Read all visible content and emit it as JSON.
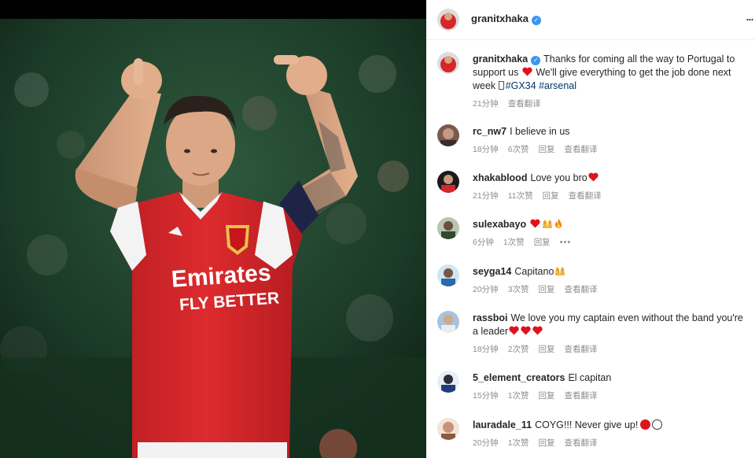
{
  "post": {
    "author": "granitxhaka",
    "verified": true,
    "more_label": "...",
    "photo_jersey_sponsor_line1": "Emirates",
    "photo_jersey_sponsor_line2": "FLY BETTER"
  },
  "caption": {
    "user": "granitxhaka",
    "text_a": "Thanks for coming all the way to Portugal to support us",
    "text_b": "We'll give everything to get the job done next week",
    "hashtag_1": "#GX34",
    "hashtag_2": "#arsenal",
    "time": "21分钟",
    "translate": "查看翻译"
  },
  "labels": {
    "reply": "回复",
    "translate": "查看翻译"
  },
  "comments": [
    {
      "user": "rc_nw7",
      "text": "I believe in us",
      "time": "18分钟",
      "likes": "6次赞"
    },
    {
      "user": "xhakablood",
      "text": "Love you bro",
      "time": "21分钟",
      "likes": "11次赞"
    },
    {
      "user": "sulexabayo",
      "text": "",
      "time": "6分钟",
      "likes": "1次赞",
      "more": "•••"
    },
    {
      "user": "seyga14",
      "text": "Capitano",
      "time": "20分钟",
      "likes": "3次赞"
    },
    {
      "user": "rassboi",
      "text": "We love you my captain even without the band you're a leader",
      "time": "18分钟",
      "likes": "2次赞"
    },
    {
      "user": "5_element_creators",
      "text": "El capitan",
      "time": "15分钟",
      "likes": "1次赞"
    },
    {
      "user": "lauradale_11",
      "text": "COYG!!! Never give up!",
      "time": "20分钟",
      "likes": "1次赞"
    }
  ],
  "colors": {
    "heart": "#e0131c",
    "hashtag": "#00376b",
    "verified": "#3897f0",
    "meta": "#8e8e8e",
    "arsenal_red": "#d6262a"
  },
  "icons": [
    "verified-badge-icon",
    "more-options-icon",
    "heart-emoji",
    "raised-hands-emoji",
    "fire-emoji",
    "red-circle-emoji",
    "white-circle-emoji"
  ]
}
